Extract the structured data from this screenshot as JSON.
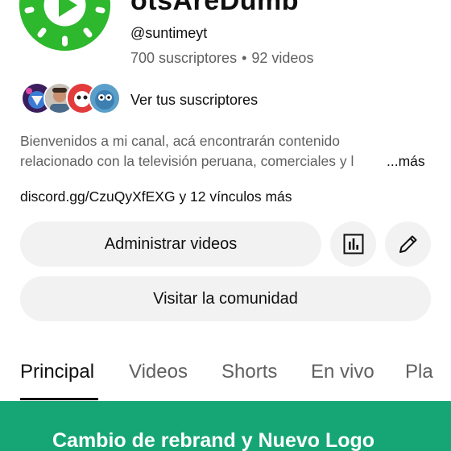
{
  "channel": {
    "title": "otsAreDumb",
    "handle": "@suntimeyt",
    "subscribers": "700 suscriptores",
    "separator": "•",
    "videos": "92 videos",
    "avatar_icon": "sun-play-logo-icon",
    "avatar_color": "#2eb82e"
  },
  "subscribers_preview": {
    "label": "Ver tus suscriptores"
  },
  "description": {
    "line1": "Bienvenidos a mi canal, acá encontrarán contenido",
    "line2": "relacionado con la televisión peruana, comerciales y l",
    "more": "...más"
  },
  "links": {
    "main": "discord.gg/CzuQyXfEXG",
    "extra": " y 12 vínculos más"
  },
  "actions": {
    "manage_videos": "Administrar videos",
    "stats_icon": "analytics-icon",
    "edit_icon": "pencil-icon",
    "visit_community": "Visitar la comunidad"
  },
  "tabs": [
    {
      "label": "Principal",
      "active": true
    },
    {
      "label": "Videos",
      "active": false
    },
    {
      "label": "Shorts",
      "active": false
    },
    {
      "label": "En vivo",
      "active": false
    },
    {
      "label": "Pla",
      "active": false
    }
  ],
  "banner": {
    "text": "Cambio de rebrand y Nuevo Logo",
    "color": "#16a676"
  }
}
